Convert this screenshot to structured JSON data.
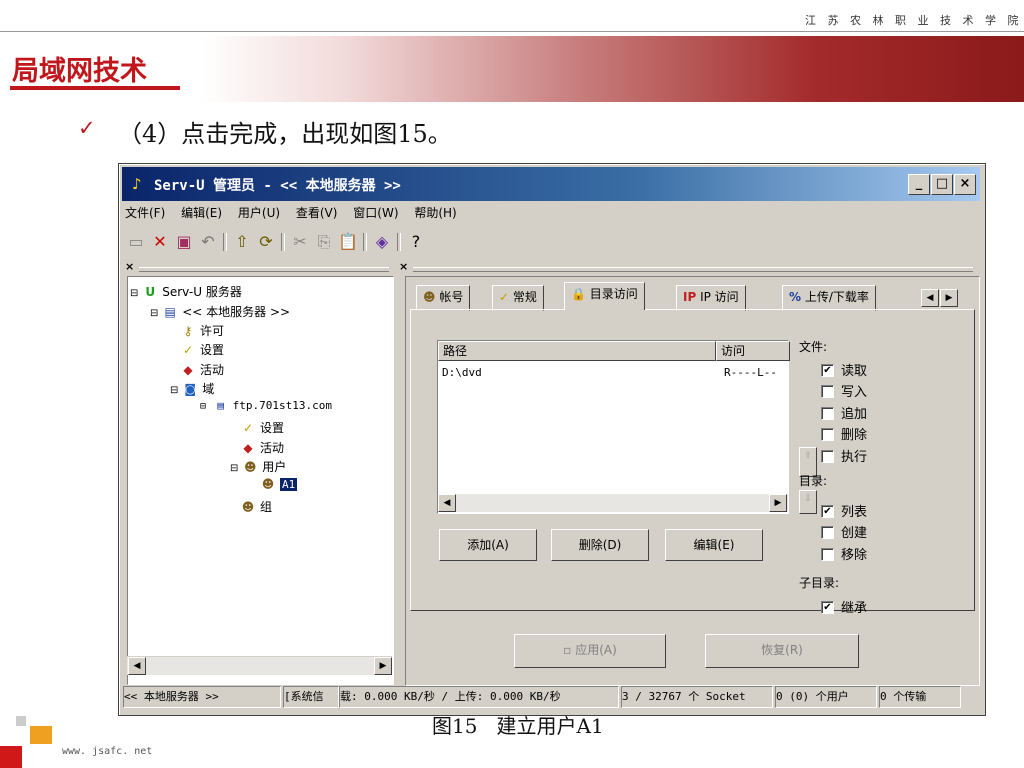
{
  "slide": {
    "college_name": "江 苏 农 林 职 业 技 术 学 院",
    "title": "局域网技术",
    "bullet_check": "✓",
    "bullet_text": "（4）点击完成，出现如图15。",
    "caption": "图15   建立用户A1",
    "footer_url": "www. jsafc. net"
  },
  "window": {
    "title": "Serv-U 管理员 - << 本地服务器 >>",
    "controls": {
      "minimize": "_",
      "maximize": "□",
      "close": "×"
    },
    "menu": [
      "文件(F)",
      "编辑(E)",
      "用户(U)",
      "查看(V)",
      "窗口(W)",
      "帮助(H)"
    ]
  },
  "toolbar": {
    "icons": [
      "folder-icon",
      "delete-icon",
      "new-user-icon",
      "undo-icon",
      "up-folder-icon",
      "refresh-icon",
      "cut-icon",
      "copy-icon",
      "paste-icon",
      "book-icon",
      "help-icon"
    ]
  },
  "tree": {
    "close_glyph": "×",
    "nodes": [
      {
        "label": "Serv-U 服务器",
        "icon": "serv-u-icon"
      },
      {
        "label": "<< 本地服务器 >>",
        "icon": "server-icon"
      },
      {
        "label": "许可",
        "icon": "key-icon"
      },
      {
        "label": "设置",
        "icon": "settings-icon"
      },
      {
        "label": "活动",
        "icon": "activity-icon"
      },
      {
        "label": "域",
        "icon": "domain-icon"
      },
      {
        "label": "ftp.701st13.com",
        "icon": "computer-icon"
      },
      {
        "label": "设置",
        "icon": "settings-icon"
      },
      {
        "label": "活动",
        "icon": "activity-icon"
      },
      {
        "label": "用户",
        "icon": "users-icon"
      },
      {
        "label": "A1",
        "icon": "user-icon"
      },
      {
        "label": "组",
        "icon": "group-icon"
      }
    ]
  },
  "tabs": [
    "帐号",
    "常规",
    "目录访问",
    "IP 访问",
    "上传/下载率"
  ],
  "dir_access": {
    "columns": [
      "路径",
      "访问"
    ],
    "rows": [
      {
        "path": "D:\\dvd",
        "access": "R----L--"
      }
    ],
    "buttons": [
      "添加(A)",
      "删除(D)",
      "编辑(E)"
    ],
    "files_label": "文件:",
    "file_perms": [
      {
        "label": "读取",
        "checked": true
      },
      {
        "label": "写入",
        "checked": false
      },
      {
        "label": "追加",
        "checked": false
      },
      {
        "label": "删除",
        "checked": false
      },
      {
        "label": "执行",
        "checked": false
      }
    ],
    "dirs_label": "目录:",
    "dir_perms": [
      {
        "label": "列表",
        "checked": true
      },
      {
        "label": "创建",
        "checked": false
      },
      {
        "label": "移除",
        "checked": false
      }
    ],
    "subdir_label": "子目录:",
    "subdir_perms": [
      {
        "label": "继承",
        "checked": true
      }
    ],
    "apply_button": "应用(A)",
    "restore_button": "恢复(R)"
  },
  "status": {
    "server": "<< 本地服务器 >>",
    "system": "[系统信",
    "transfer": "载: 0.000 KB/秒 / 上传: 0.000 KB/秒",
    "sockets": "3 / 32767 个 Socket",
    "users": "0 (0) 个用户",
    "transfers": "0 个传输"
  },
  "colors": {
    "title_red": "#c0161c",
    "titlebar": "#0a246a",
    "face": "#d4d0c8"
  }
}
